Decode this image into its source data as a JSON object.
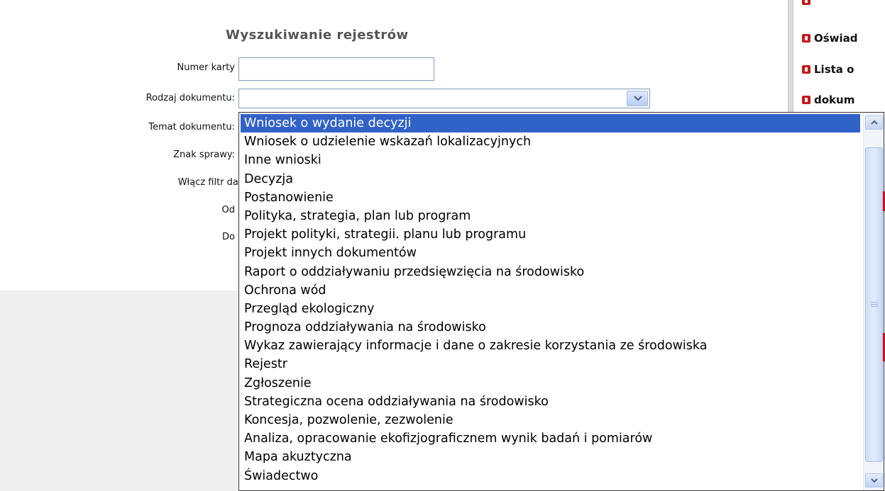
{
  "form": {
    "title": "Wyszukiwanie rejestrów",
    "labels": {
      "card_number": "Numer karty",
      "doc_type": "Rodzaj dokumentu:",
      "doc_subject": "Temat dokumentu:",
      "case_sign": "Znak sprawy:",
      "date_filter": "Włącz filtr dat",
      "from": "Od",
      "to": "Do"
    },
    "card_number_value": "",
    "doc_type_value": ""
  },
  "dropdown": {
    "options": [
      "Wniosek o wydanie decyzji",
      "Wniosek o udzielenie wskazań lokalizacyjnych",
      "Inne wnioski",
      "Decyzja",
      "Postanowienie",
      "Polityka, strategia, plan lub program",
      "Projekt polityki, strategii. planu lub programu",
      "Projekt innych dokumentów",
      "Raport o oddziaływaniu przedsięwzięcia na środowisko",
      "Ochrona wód",
      "Przegląd ekologiczny",
      "Prognoza oddziaływania na środowisko",
      "Wykaz zawierający informacje i dane o zakresie korzystania ze środowiska",
      "Rejestr",
      "Zgłoszenie",
      "Strategiczna ocena oddziaływania na środowisko",
      "Koncesja, pozwolenie, zezwolenie",
      "Analiza, opracowanie ekofizjograficznem wynik badań i pomiarów",
      "Mapa akuztyczna",
      "Świadectwo"
    ],
    "selected_index": 0
  },
  "sidebar": {
    "items": [
      "Oświad",
      "Lista o",
      "dokum"
    ],
    "icon": "red-square-bullet-icon",
    "accent_color": "#c4181b"
  },
  "colors": {
    "selection": "#3162c7",
    "title": "#555555"
  }
}
